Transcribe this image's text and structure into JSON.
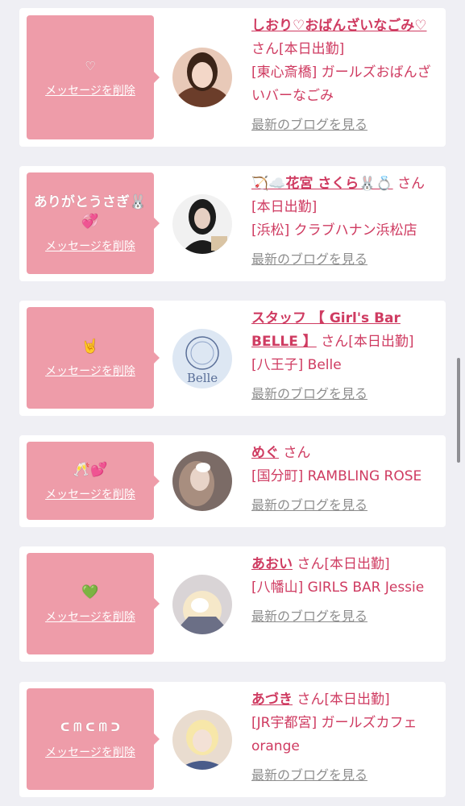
{
  "cards": [
    {
      "message": "♡",
      "delete_label": "メッセージを削除",
      "name": "しおり♡おばんざいなごみ♡",
      "san": "さん",
      "status": "[本日出勤]",
      "shop": "[東心斎橋] ガールズおばんざいバーなごみ",
      "blog_label": "最新のブログを見る",
      "avatar_colors": [
        "#6b3d2a",
        "#f3d7c8",
        "#2b1a12"
      ]
    },
    {
      "message": "ありがとうさぎ🐰💞",
      "delete_label": "メッセージを削除",
      "name": "🏹☁️花宮 さくら🐰💍",
      "san": "さん",
      "status": "[本日出勤]",
      "shop": "[浜松] クラブハナン浜松店",
      "blog_label": "最新のブログを見る",
      "avatar_colors": [
        "#1c1c1c",
        "#f4f4f4",
        "#e6cfc2"
      ]
    },
    {
      "message": "🤘",
      "delete_label": "メッセージを削除",
      "name": "スタッフ 【 Girl's Bar BELLE 】",
      "san": "さん",
      "status": "[本日出勤]",
      "shop": "[八王子] Belle",
      "blog_label": "最新のブログを見る",
      "avatar_colors": [
        "#c6d6ea",
        "#eef3fa",
        "#5a6f98"
      ],
      "avatar_text": "Belle"
    },
    {
      "message": "🥂💕",
      "delete_label": "メッセージを削除",
      "name": "めぐ",
      "san": "さん",
      "status": "",
      "shop": "[国分町] RAMBLING ROSE",
      "blog_label": "最新のブログを見る",
      "avatar_colors": [
        "#7b6b66",
        "#e8d4c8",
        "#3a2f2b"
      ]
    },
    {
      "message": "💚",
      "delete_label": "メッセージを削除",
      "name": "あおい",
      "san": "さん",
      "status": "[本日出勤]",
      "shop": "[八幡山] GIRLS BAR Jessie",
      "blog_label": "最新のブログを見る",
      "avatar_colors": [
        "#d9d4d6",
        "#f6e8c9",
        "#6b6f86"
      ]
    },
    {
      "message": "ᑕ ᗰ ᑕ ᗰ ᑐ",
      "delete_label": "メッセージを削除",
      "name": "あづき",
      "san": "さん",
      "status": "[本日出勤]",
      "shop": "[JR宇都宮] ガールズカフェorange",
      "blog_label": "最新のブログを見る",
      "avatar_colors": [
        "#e9dccf",
        "#f7e7a9",
        "#4a5c8a"
      ]
    }
  ]
}
